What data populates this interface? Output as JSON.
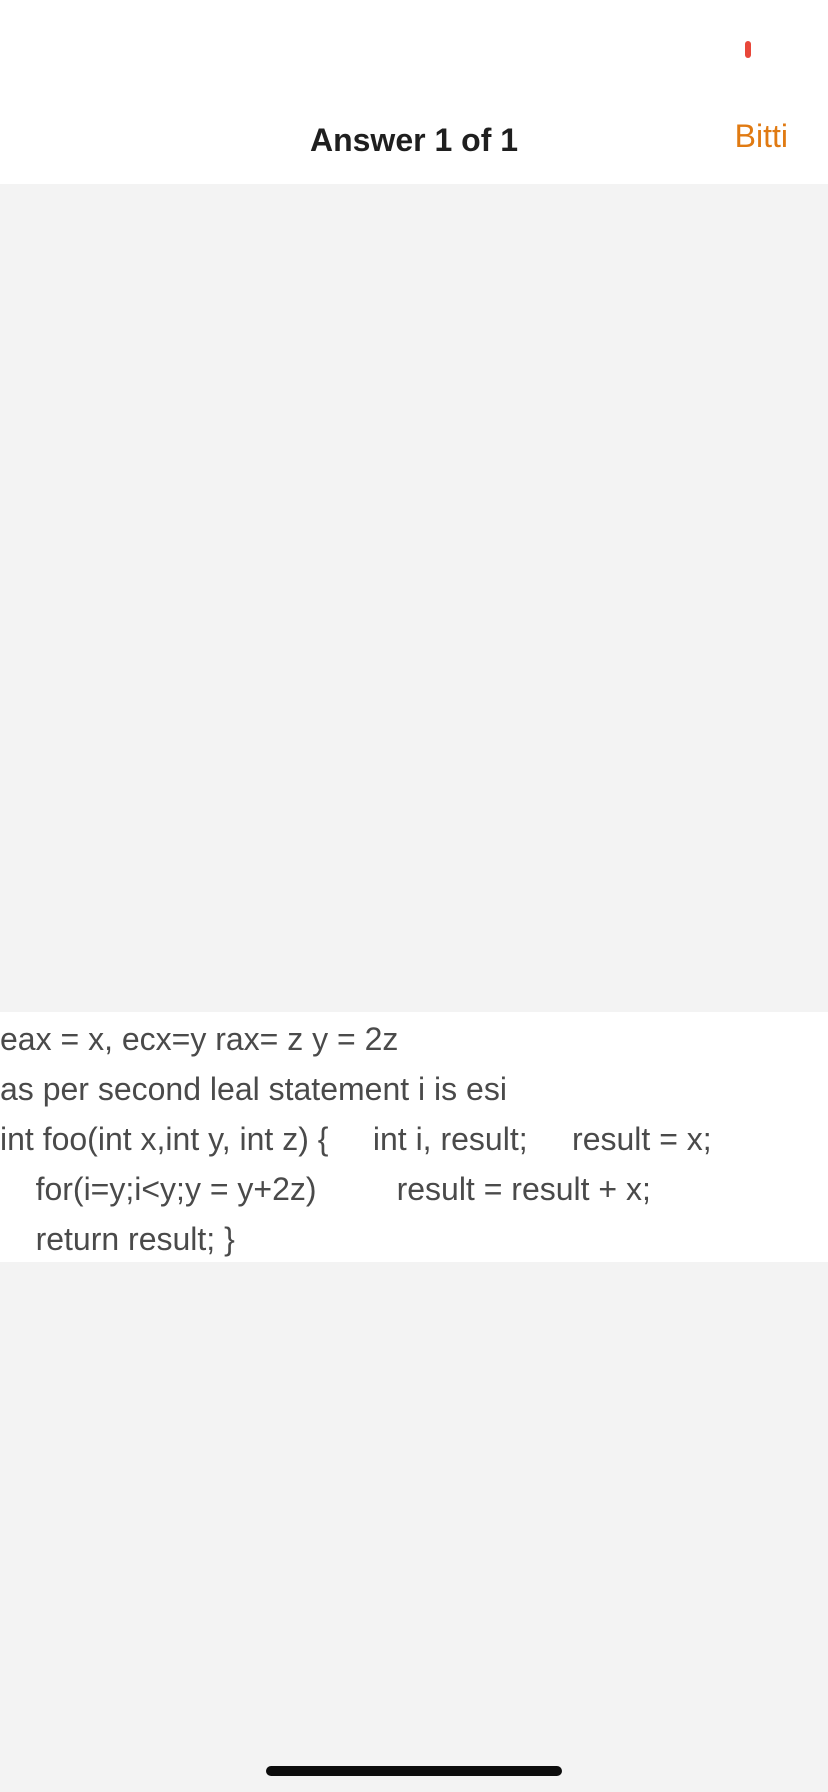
{
  "nav": {
    "title": "Answer 1 of 1",
    "done_label": "Bitti"
  },
  "status": {
    "indicator_color": "#e8473a"
  },
  "answer": {
    "lines": [
      "eax = x, ecx=y rax= z y = 2z",
      "as per second leal statement i is esi",
      "int foo(int x,int y, int z) {     int i, result;     result = x;",
      "    for(i=y;i<y;y = y+2z)         result = result + x;",
      "    return result; }"
    ]
  },
  "colors": {
    "accent": "#e07a12",
    "background": "#f3f3f3",
    "text": "#4a4a4a"
  }
}
